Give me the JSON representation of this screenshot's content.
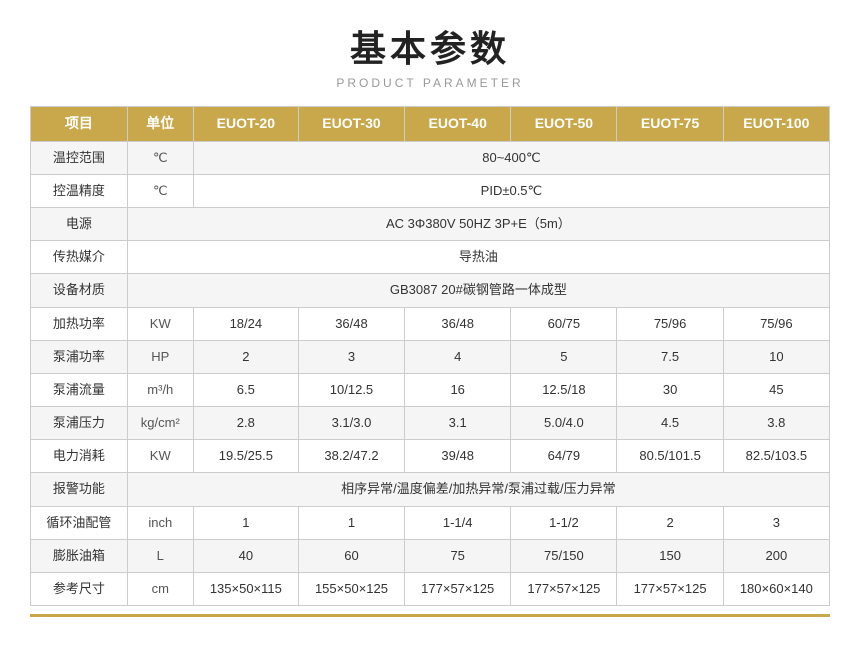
{
  "header": {
    "main_title": "基本参数",
    "sub_title": "PRODUCT PARAMETER"
  },
  "table": {
    "columns": [
      {
        "label": "项目",
        "key": "name"
      },
      {
        "label": "单位",
        "key": "unit"
      },
      {
        "label": "EUOT-20",
        "key": "euot20"
      },
      {
        "label": "EUOT-30",
        "key": "euot30"
      },
      {
        "label": "EUOT-40",
        "key": "euot40"
      },
      {
        "label": "EUOT-50",
        "key": "euot50"
      },
      {
        "label": "EUOT-75",
        "key": "euot75"
      },
      {
        "label": "EUOT-100",
        "key": "euot100"
      }
    ],
    "rows": [
      {
        "name": "温控范围",
        "unit": "℃",
        "merged": true,
        "merged_value": "80~400℃",
        "merged_cols": 6
      },
      {
        "name": "控温精度",
        "unit": "℃",
        "merged": true,
        "merged_value": "PID±0.5℃",
        "merged_cols": 6
      },
      {
        "name": "电源",
        "unit": "",
        "merged": true,
        "merged_value": "AC 3Φ380V 50HZ 3P+E（5m）",
        "merged_cols": 7
      },
      {
        "name": "传热媒介",
        "unit": "",
        "merged": true,
        "merged_value": "导热油",
        "merged_cols": 7
      },
      {
        "name": "设备材质",
        "unit": "",
        "merged": true,
        "merged_value": "GB3087   20#碳钢管路一体成型",
        "merged_cols": 7
      },
      {
        "name": "加热功率",
        "unit": "KW",
        "merged": false,
        "euot20": "18/24",
        "euot30": "36/48",
        "euot40": "36/48",
        "euot50": "60/75",
        "euot75": "75/96",
        "euot100": "75/96"
      },
      {
        "name": "泵浦功率",
        "unit": "HP",
        "merged": false,
        "euot20": "2",
        "euot30": "3",
        "euot40": "4",
        "euot50": "5",
        "euot75": "7.5",
        "euot100": "10"
      },
      {
        "name": "泵浦流量",
        "unit": "m³/h",
        "merged": false,
        "euot20": "6.5",
        "euot30": "10/12.5",
        "euot40": "16",
        "euot50": "12.5/18",
        "euot75": "30",
        "euot100": "45"
      },
      {
        "name": "泵浦压力",
        "unit": "kg/cm²",
        "merged": false,
        "euot20": "2.8",
        "euot30": "3.1/3.0",
        "euot40": "3.1",
        "euot50": "5.0/4.0",
        "euot75": "4.5",
        "euot100": "3.8"
      },
      {
        "name": "电力消耗",
        "unit": "KW",
        "merged": false,
        "euot20": "19.5/25.5",
        "euot30": "38.2/47.2",
        "euot40": "39/48",
        "euot50": "64/79",
        "euot75": "80.5/101.5",
        "euot100": "82.5/103.5"
      },
      {
        "name": "报警功能",
        "unit": "",
        "merged": true,
        "merged_value": "相序异常/温度偏差/加热异常/泵浦过载/压力异常",
        "merged_cols": 7
      },
      {
        "name": "循环油配管",
        "unit": "inch",
        "merged": false,
        "euot20": "1",
        "euot30": "1",
        "euot40": "1-1/4",
        "euot50": "1-1/2",
        "euot75": "2",
        "euot100": "3"
      },
      {
        "name": "膨胀油箱",
        "unit": "L",
        "merged": false,
        "euot20": "40",
        "euot30": "60",
        "euot40": "75",
        "euot50": "75/150",
        "euot75": "150",
        "euot100": "200"
      },
      {
        "name": "参考尺寸",
        "unit": "cm",
        "merged": false,
        "euot20": "135×50×115",
        "euot30": "155×50×125",
        "euot40": "177×57×125",
        "euot50": "177×57×125",
        "euot75": "177×57×125",
        "euot100": "180×60×140"
      }
    ]
  }
}
